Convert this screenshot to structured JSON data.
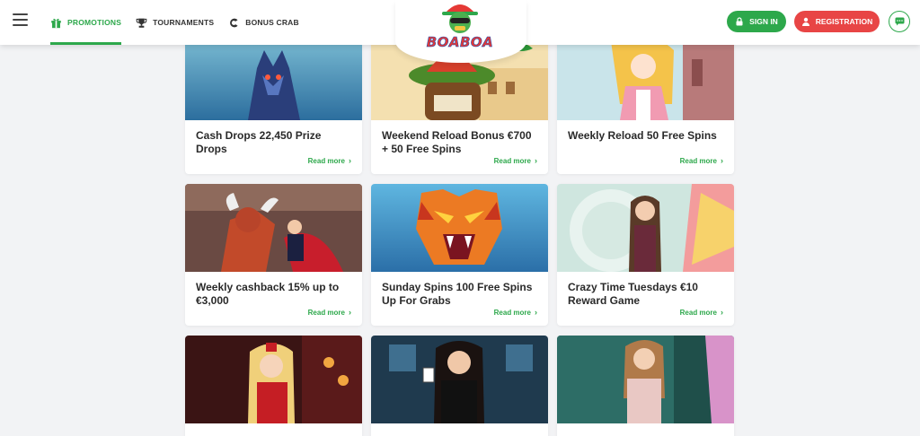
{
  "header": {
    "nav": [
      {
        "label": "PROMOTIONS",
        "icon": "gift-icon",
        "active": true
      },
      {
        "label": "TOURNAMENTS",
        "icon": "trophy-icon",
        "active": false
      },
      {
        "label": "BONUS CRAB",
        "icon": "crab-claw-icon",
        "active": false
      }
    ],
    "logo_text": "BOABOA",
    "signin_label": "SIGN IN",
    "registration_label": "REGISTRATION"
  },
  "colors": {
    "accent": "#2da84b",
    "danger": "#e84545"
  },
  "cards": [
    {
      "title": "Cash Drops 22,450 Prize Drops",
      "link": "Read more",
      "image": "wolf-illustration"
    },
    {
      "title": "Weekend Reload Bonus €700 + 50 Free Spins",
      "link": "Read more",
      "image": "sombrero-slot-character"
    },
    {
      "title": "Weekly Reload 50 Free Spins",
      "link": "Read more",
      "image": "anime-waitress"
    },
    {
      "title": "Weekly cashback 15% up to €3,000",
      "link": "Read more",
      "image": "bull-matador"
    },
    {
      "title": "Sunday Spins 100 Free Spins Up For Grabs",
      "link": "Read more",
      "image": "tiger-mask"
    },
    {
      "title": "Crazy Time Tuesdays €10 Reward Game",
      "link": "Read more",
      "image": "live-dealer-crazy-time"
    },
    {
      "title": "",
      "link": "",
      "image": "live-dealer-red-uniform"
    },
    {
      "title": "",
      "link": "",
      "image": "blackjack-dealer"
    },
    {
      "title": "",
      "link": "",
      "image": "roulette-dealer"
    }
  ]
}
